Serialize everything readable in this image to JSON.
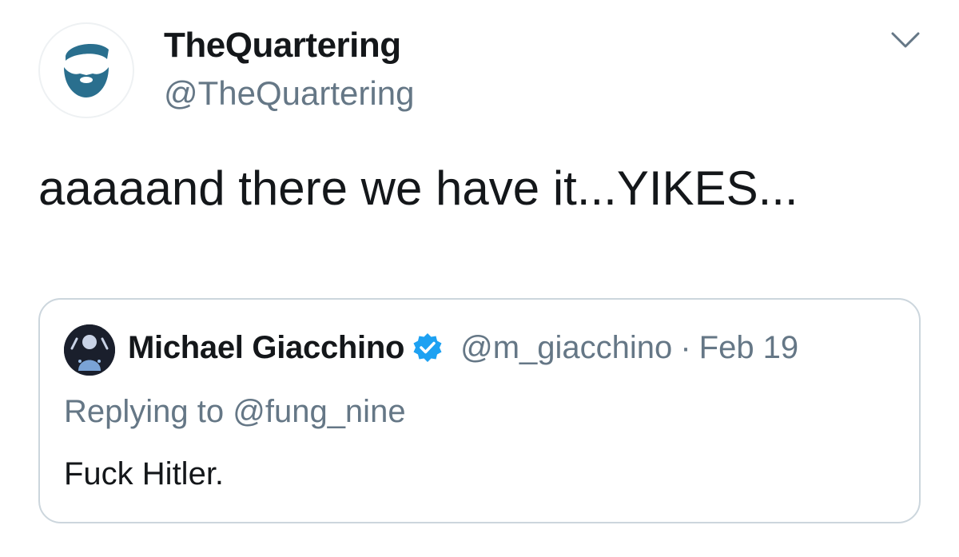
{
  "tweet": {
    "display_name": "TheQuartering",
    "handle": "@TheQuartering",
    "text": "aaaaand there we have it...YIKES...",
    "avatar_icon": "bearded-man-icon",
    "menu_icon": "chevron-down-icon"
  },
  "quoted": {
    "display_name": "Michael Giacchino",
    "verified_icon": "verified-badge-icon",
    "handle": "@m_giacchino",
    "separator": "·",
    "date": "Feb 19",
    "replying_to": "Replying to @fung_nine",
    "text": "Fuck Hitler."
  },
  "colors": {
    "text": "#14171a",
    "secondary": "#657786",
    "border": "#ccd6dd",
    "verified": "#1da1f2",
    "avatar_teal": "#2a6f8e"
  }
}
